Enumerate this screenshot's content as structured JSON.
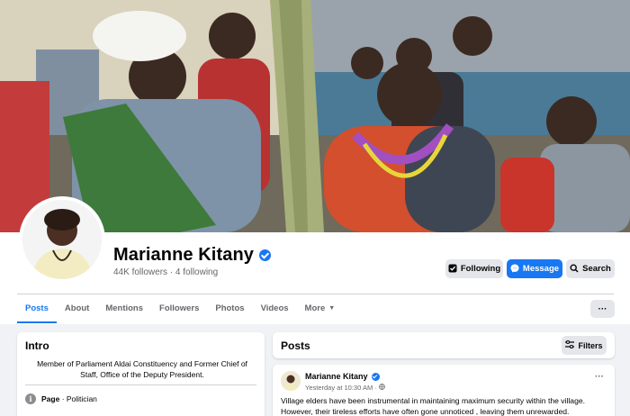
{
  "profile": {
    "name": "Marianne Kitany",
    "followers": "44K followers",
    "following": "4 following",
    "separator": " · "
  },
  "actions": {
    "following_label": "Following",
    "message_label": "Message",
    "search_label": "Search"
  },
  "tabs": [
    {
      "label": "Posts",
      "active": true
    },
    {
      "label": "About"
    },
    {
      "label": "Mentions"
    },
    {
      "label": "Followers"
    },
    {
      "label": "Photos"
    },
    {
      "label": "Videos"
    },
    {
      "label": "More"
    }
  ],
  "more_menu_label": "···",
  "intro": {
    "title": "Intro",
    "bio": "Member of Parliament Aldai Constituency and Former Chief of Staff, Office of the Deputy President.",
    "page_label": "Page",
    "page_category": " · Politician"
  },
  "posts": {
    "title": "Posts",
    "filters_label": "Filters",
    "items": [
      {
        "author": "Marianne Kitany",
        "time": "Yesterday at 10:30 AM · ",
        "text": "Village elders have been instrumental in maintaining maximum security within the village. However, their tireless efforts have often gone unnoticed , leaving them unrewarded."
      }
    ]
  },
  "colors": {
    "accent": "#1877f2",
    "background": "#f0f2f5",
    "button_gray": "#e4e6eb",
    "secondary_text": "#65676b"
  },
  "icons": {
    "verified": "verified-badge-icon",
    "following": "following-check-icon",
    "message": "messenger-icon",
    "search": "search-icon",
    "caret": "caret-down-icon",
    "info": "info-icon",
    "filters": "filters-icon",
    "globe": "globe-icon"
  }
}
